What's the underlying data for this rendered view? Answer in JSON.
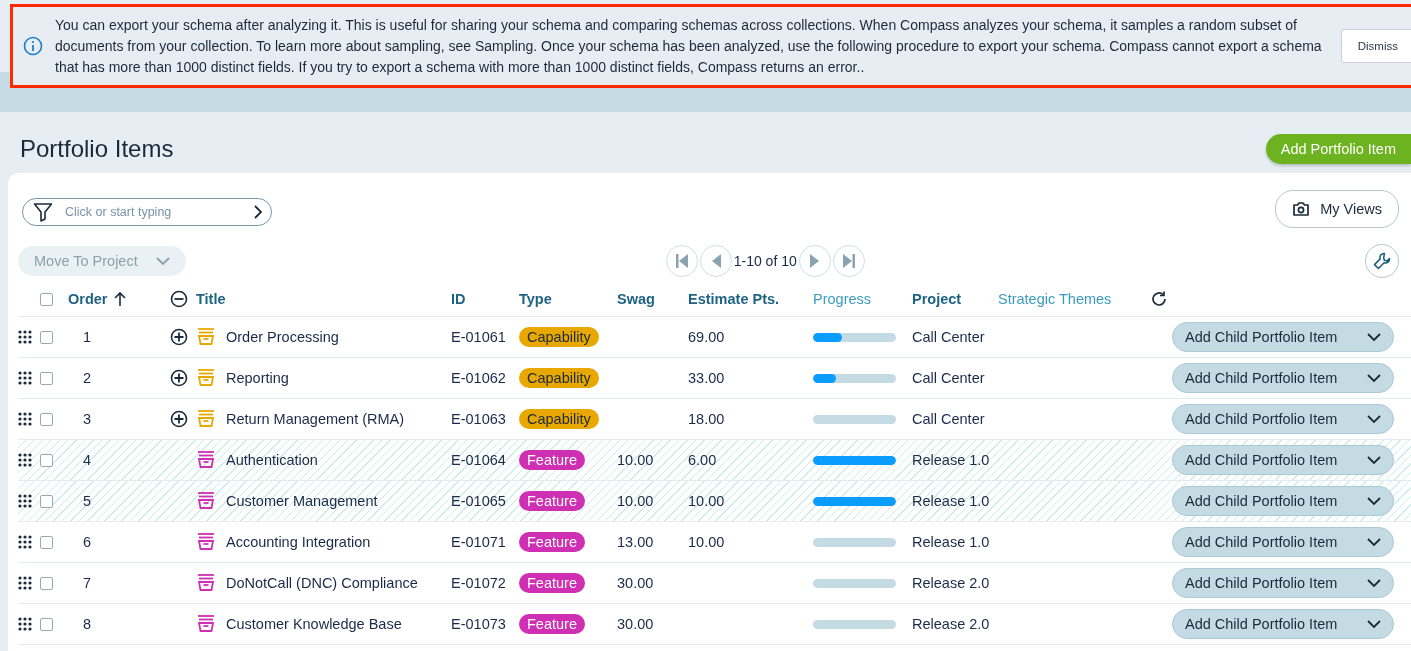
{
  "banner": {
    "text": "You can export your schema after analyzing it. This is useful for sharing your schema and comparing schemas across collections. When Compass analyzes your schema, it samples a random subset of documents from your collection. To learn more about sampling, see Sampling. Once your schema has been analyzed, use the following procedure to export your schema. Compass cannot export a schema that has more than 1000 distinct fields. If you try to export a schema with more than 1000 distinct fields, Compass returns an error..",
    "button": "Dismiss"
  },
  "select_all": {
    "checked": false
  },
  "page": {
    "title": "Portfolio Items",
    "add_button": "Add Portfolio Item"
  },
  "filter": {
    "placeholder": "Click or start typing"
  },
  "my_views": "My Views",
  "move_button": {
    "label": "Move To Project",
    "disabled": true
  },
  "pager": {
    "text": "1-10 of 10"
  },
  "table": {
    "columns": [
      {
        "label": "Order",
        "sortable": true
      },
      {
        "label": "Title",
        "sortable": true
      },
      {
        "label": "ID",
        "sortable": true
      },
      {
        "label": "Type",
        "sortable": true
      },
      {
        "label": "Swag",
        "sortable": true
      },
      {
        "label": "Estimate Pts.",
        "sortable": true
      },
      {
        "label": "Progress",
        "sortable": false
      },
      {
        "label": "Project",
        "sortable": true
      },
      {
        "label": "Strategic Themes",
        "sortable": false
      }
    ],
    "rows": [
      {
        "order": "1",
        "checked": false,
        "kind": "capability",
        "expandable": true,
        "hatched": false,
        "title": "Order Processing",
        "id": "E-01061",
        "type": "Capability",
        "swag": "",
        "estimate": "69.00",
        "level": 0.35,
        "project": "Call Center",
        "action": "Add Child Portfolio Item"
      },
      {
        "order": "2",
        "checked": false,
        "kind": "capability",
        "expandable": true,
        "hatched": false,
        "title": "Reporting",
        "id": "E-01062",
        "type": "Capability",
        "swag": "",
        "estimate": "33.00",
        "level": 0.28,
        "project": "Call Center",
        "action": "Add Child Portfolio Item"
      },
      {
        "order": "3",
        "checked": false,
        "kind": "capability",
        "expandable": true,
        "hatched": false,
        "title": "Return Management (RMA)",
        "id": "E-01063",
        "type": "Capability",
        "swag": "",
        "estimate": "18.00",
        "level": 0,
        "project": "Call Center",
        "action": "Add Child Portfolio Item"
      },
      {
        "order": "4",
        "checked": false,
        "kind": "feature",
        "expandable": false,
        "hatched": true,
        "title": "Authentication",
        "id": "E-01064",
        "type": "Feature",
        "swag": "10.00",
        "estimate": "6.00",
        "level": 1,
        "project": "Release 1.0",
        "action": "Add Child Portfolio Item"
      },
      {
        "order": "5",
        "checked": false,
        "kind": "feature",
        "expandable": false,
        "hatched": true,
        "title": "Customer Management",
        "id": "E-01065",
        "type": "Feature",
        "swag": "10.00",
        "estimate": "10.00",
        "level": 1,
        "project": "Release 1.0",
        "action": "Add Child Portfolio Item"
      },
      {
        "order": "6",
        "checked": false,
        "kind": "feature",
        "expandable": false,
        "hatched": false,
        "title": "Accounting Integration",
        "id": "E-01071",
        "type": "Feature",
        "swag": "13.00",
        "estimate": "10.00",
        "level": 0,
        "project": "Release 1.0",
        "action": "Add Child Portfolio Item"
      },
      {
        "order": "7",
        "checked": false,
        "kind": "feature",
        "expandable": false,
        "hatched": false,
        "title": "DoNotCall (DNC) Compliance",
        "id": "E-01072",
        "type": "Feature",
        "swag": "30.00",
        "estimate": "",
        "level": 0,
        "project": "Release 2.0",
        "action": "Add Child Portfolio Item"
      },
      {
        "order": "8",
        "checked": false,
        "kind": "feature",
        "expandable": false,
        "hatched": false,
        "title": "Customer Knowledge Base",
        "id": "E-01073",
        "type": "Feature",
        "swag": "30.00",
        "estimate": "",
        "level": 0,
        "project": "Release 2.0",
        "action": "Add Child Portfolio Item"
      }
    ]
  }
}
